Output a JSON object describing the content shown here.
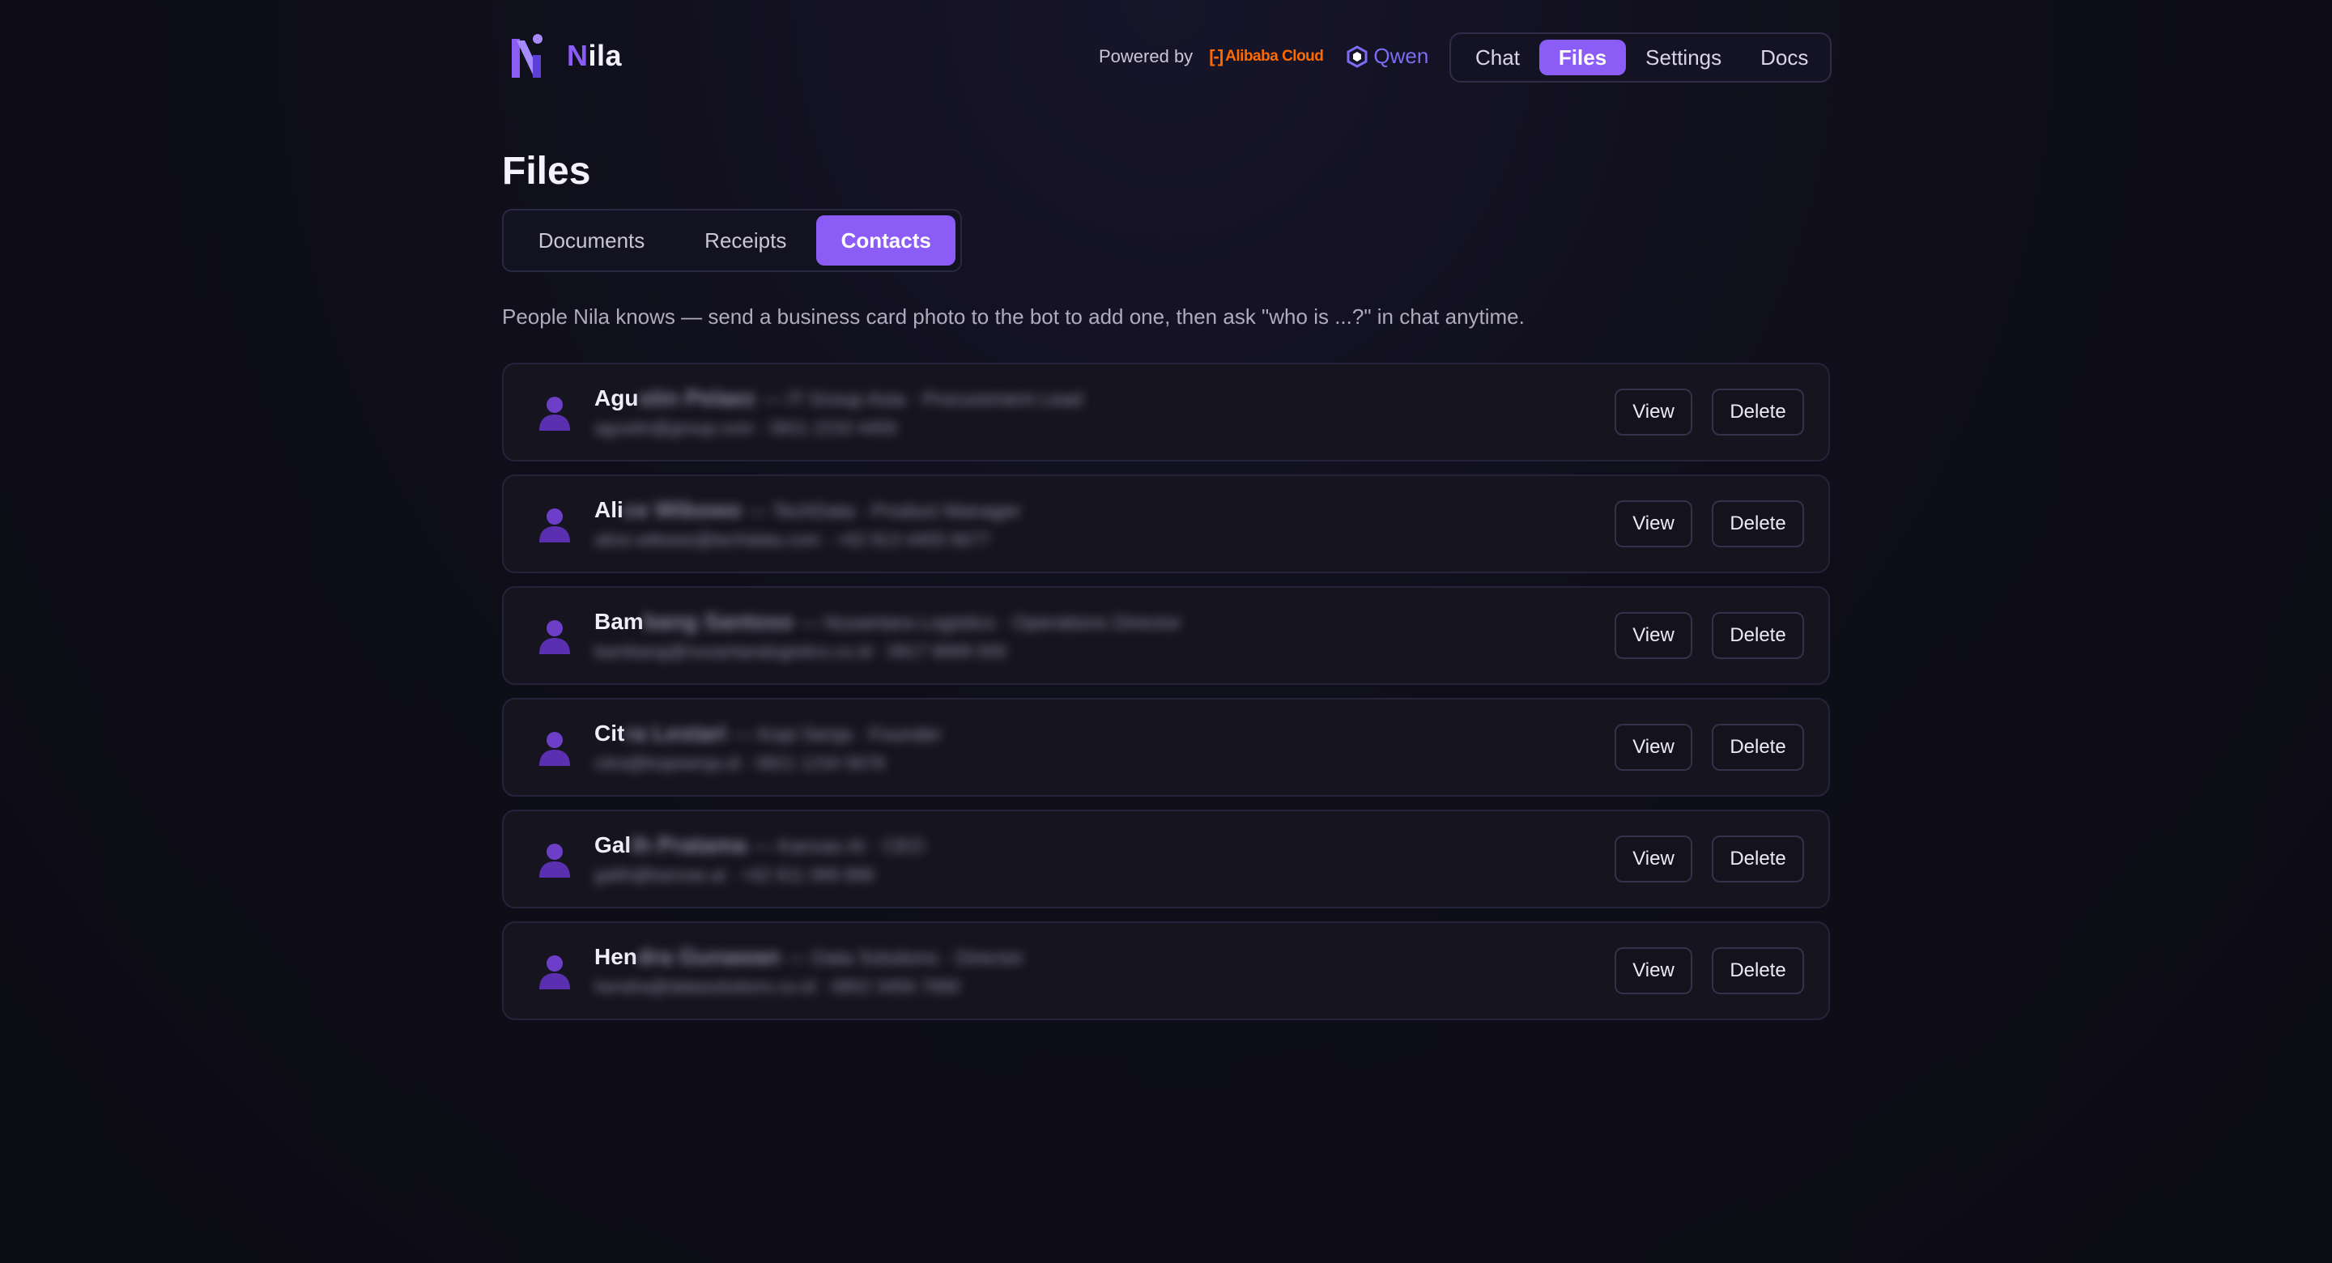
{
  "brand": {
    "initial": "N",
    "rest": "ila"
  },
  "powered_by": {
    "label": "Powered by",
    "alibaba": "Alibaba Cloud",
    "qwen": "Qwen"
  },
  "nav": {
    "items": [
      "Chat",
      "Files",
      "Settings",
      "Docs"
    ],
    "active": "Files"
  },
  "page": {
    "title": "Files",
    "tabs": [
      "Documents",
      "Receipts",
      "Contacts"
    ],
    "active_tab": "Contacts",
    "description": "People Nila knows — send a business card photo to the bot to add one, then ask \"who is ...?\" in chat anytime."
  },
  "contacts": [
    {
      "name_visible": "Agu",
      "name_hidden": "stin Pelaez",
      "title": "— IT Group Asia · Procurement Lead",
      "meta": "agustin@group.com · 0811 2233 4455"
    },
    {
      "name_visible": "Ali",
      "name_hidden": "ce Wibowo",
      "title": "— TechData · Product Manager",
      "meta": "alice.wibowo@techdata.com · +62 813 4455 6677"
    },
    {
      "name_visible": "Bam",
      "name_hidden": "bang Santoso",
      "title": "— Nusantara Logistics · Operations Director",
      "meta": "bambang@nusantaralogistics.co.id · 0817 8899 000"
    },
    {
      "name_visible": "Cit",
      "name_hidden": "ra Lestari",
      "title": "— Kopi Senja · Founder",
      "meta": "citra@kopisenja.id · 0821 1234 5678"
    },
    {
      "name_visible": "Gal",
      "name_hidden": "ih Pratama",
      "title": "— Kanvas AI · CEO",
      "meta": "galih@kanvas.ai · +62 811 999 888"
    },
    {
      "name_visible": "Hen",
      "name_hidden": "dra Gunawan",
      "title": "— Data Solutions · Director",
      "meta": "hendra@datasolutions.co.id · 0852 3456 7890"
    }
  ],
  "buttons": {
    "view": "View",
    "delete": "Delete"
  },
  "colors": {
    "accent": "#8b5cf6",
    "alibaba": "#ff6a00",
    "qwen": "#7b6cf2",
    "background": "#0f0e1a"
  }
}
